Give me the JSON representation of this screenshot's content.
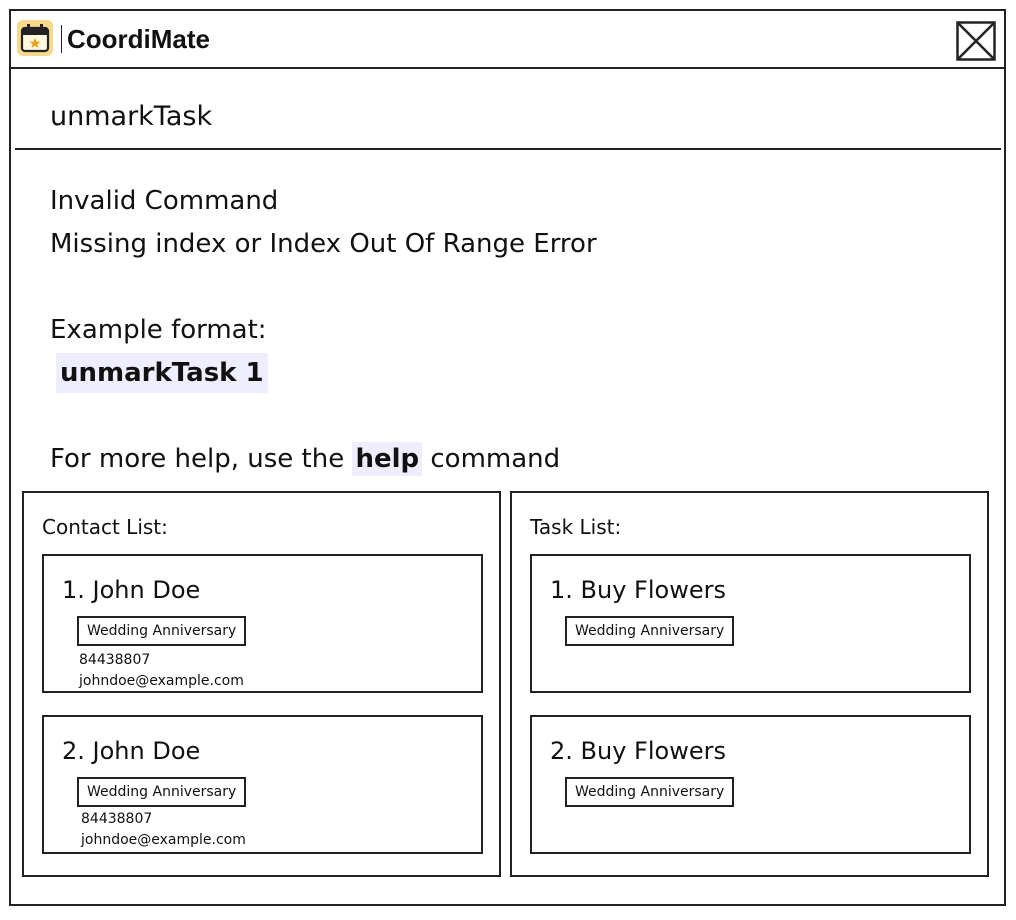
{
  "app": {
    "title": "CoordiMate",
    "icon": "calendar-star-icon",
    "close_icon": "close-icon"
  },
  "command_box": {
    "value": "unmarkTask"
  },
  "result": {
    "line1": "Invalid Command",
    "line2": "Missing index or Index Out Of Range Error",
    "example_label": "Example format:",
    "example_code": "unmarkTask 1",
    "help_prefix": "For more help, use the ",
    "help_keyword": "help",
    "help_suffix": " command"
  },
  "contact_list": {
    "title": "Contact List:",
    "items": [
      {
        "name": "1. John Doe",
        "tag": "Wedding Anniversary",
        "phone": "84438807",
        "email": "johndoe@example.com"
      },
      {
        "name": "2. John Doe",
        "tag": "Wedding Anniversary",
        "phone": "84438807",
        "email": "johndoe@example.com"
      }
    ]
  },
  "task_list": {
    "title": "Task List:",
    "items": [
      {
        "name": "1. Buy Flowers",
        "tag": "Wedding Anniversary"
      },
      {
        "name": "2. Buy Flowers",
        "tag": "Wedding Anniversary"
      }
    ]
  },
  "colors": {
    "code_highlight": "#eeeeff",
    "icon_fill": "#f6d98b",
    "border": "#222222"
  }
}
